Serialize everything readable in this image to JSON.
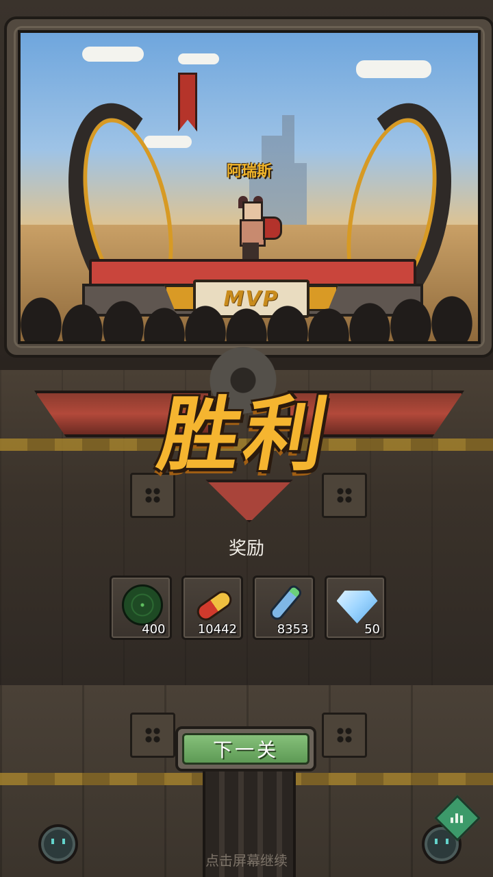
{
  "mvp_panel": {
    "hero_name": "阿瑞斯",
    "badge": "MVP"
  },
  "result": {
    "title": "胜利"
  },
  "rewards": {
    "title": "奖励",
    "items": [
      {
        "icon": "radar-icon",
        "count": "400"
      },
      {
        "icon": "pill-capsule-icon",
        "count": "10442"
      },
      {
        "icon": "bottle-icon",
        "count": "8353"
      },
      {
        "icon": "diamond-icon",
        "count": "50"
      }
    ]
  },
  "actions": {
    "next_label": "下一关",
    "tap_hint": "点击屏幕继续"
  },
  "colors": {
    "title_gold": "#f5b530",
    "button_green": "#6eaa62",
    "hero_name_gold": "#f0b429"
  }
}
